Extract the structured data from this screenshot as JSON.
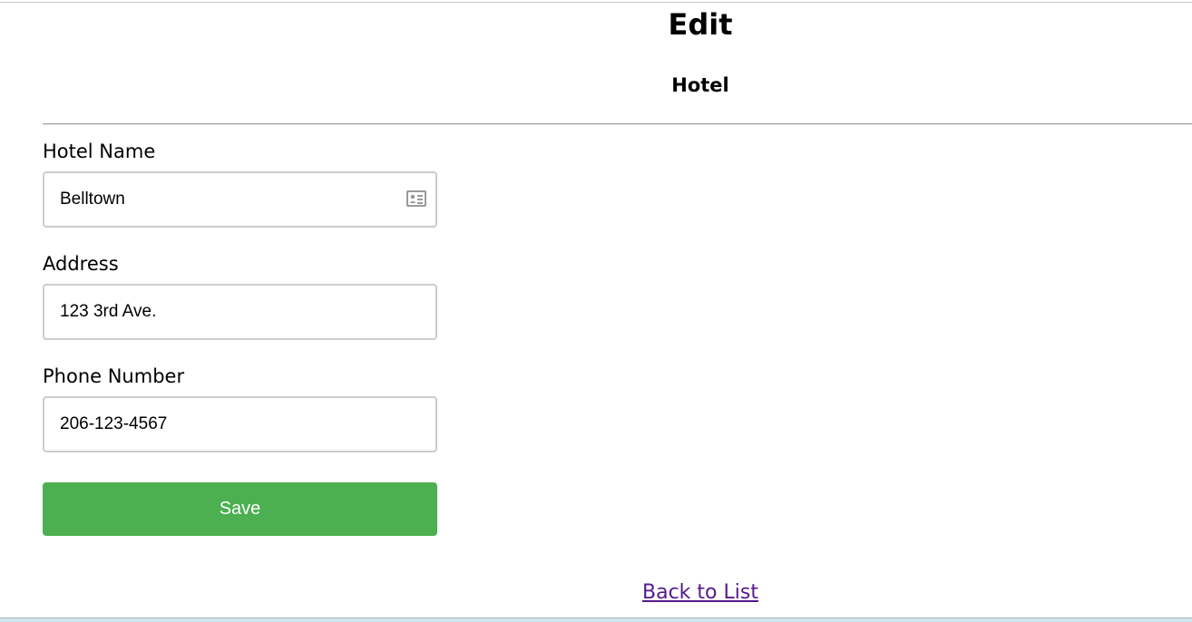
{
  "page": {
    "title": "Edit",
    "subtitle": "Hotel"
  },
  "form": {
    "hotel_name": {
      "label": "Hotel Name",
      "value": "Belltown",
      "icon": "contact-card-icon"
    },
    "address": {
      "label": "Address",
      "value": "123 3rd Ave."
    },
    "phone": {
      "label": "Phone Number",
      "value": "206-123-4567"
    },
    "save_label": "Save"
  },
  "footer": {
    "back_link": "Back to List"
  },
  "colors": {
    "save_button": "#4caf50",
    "link_visited": "#551a8b",
    "input_border": "#cccccc"
  }
}
